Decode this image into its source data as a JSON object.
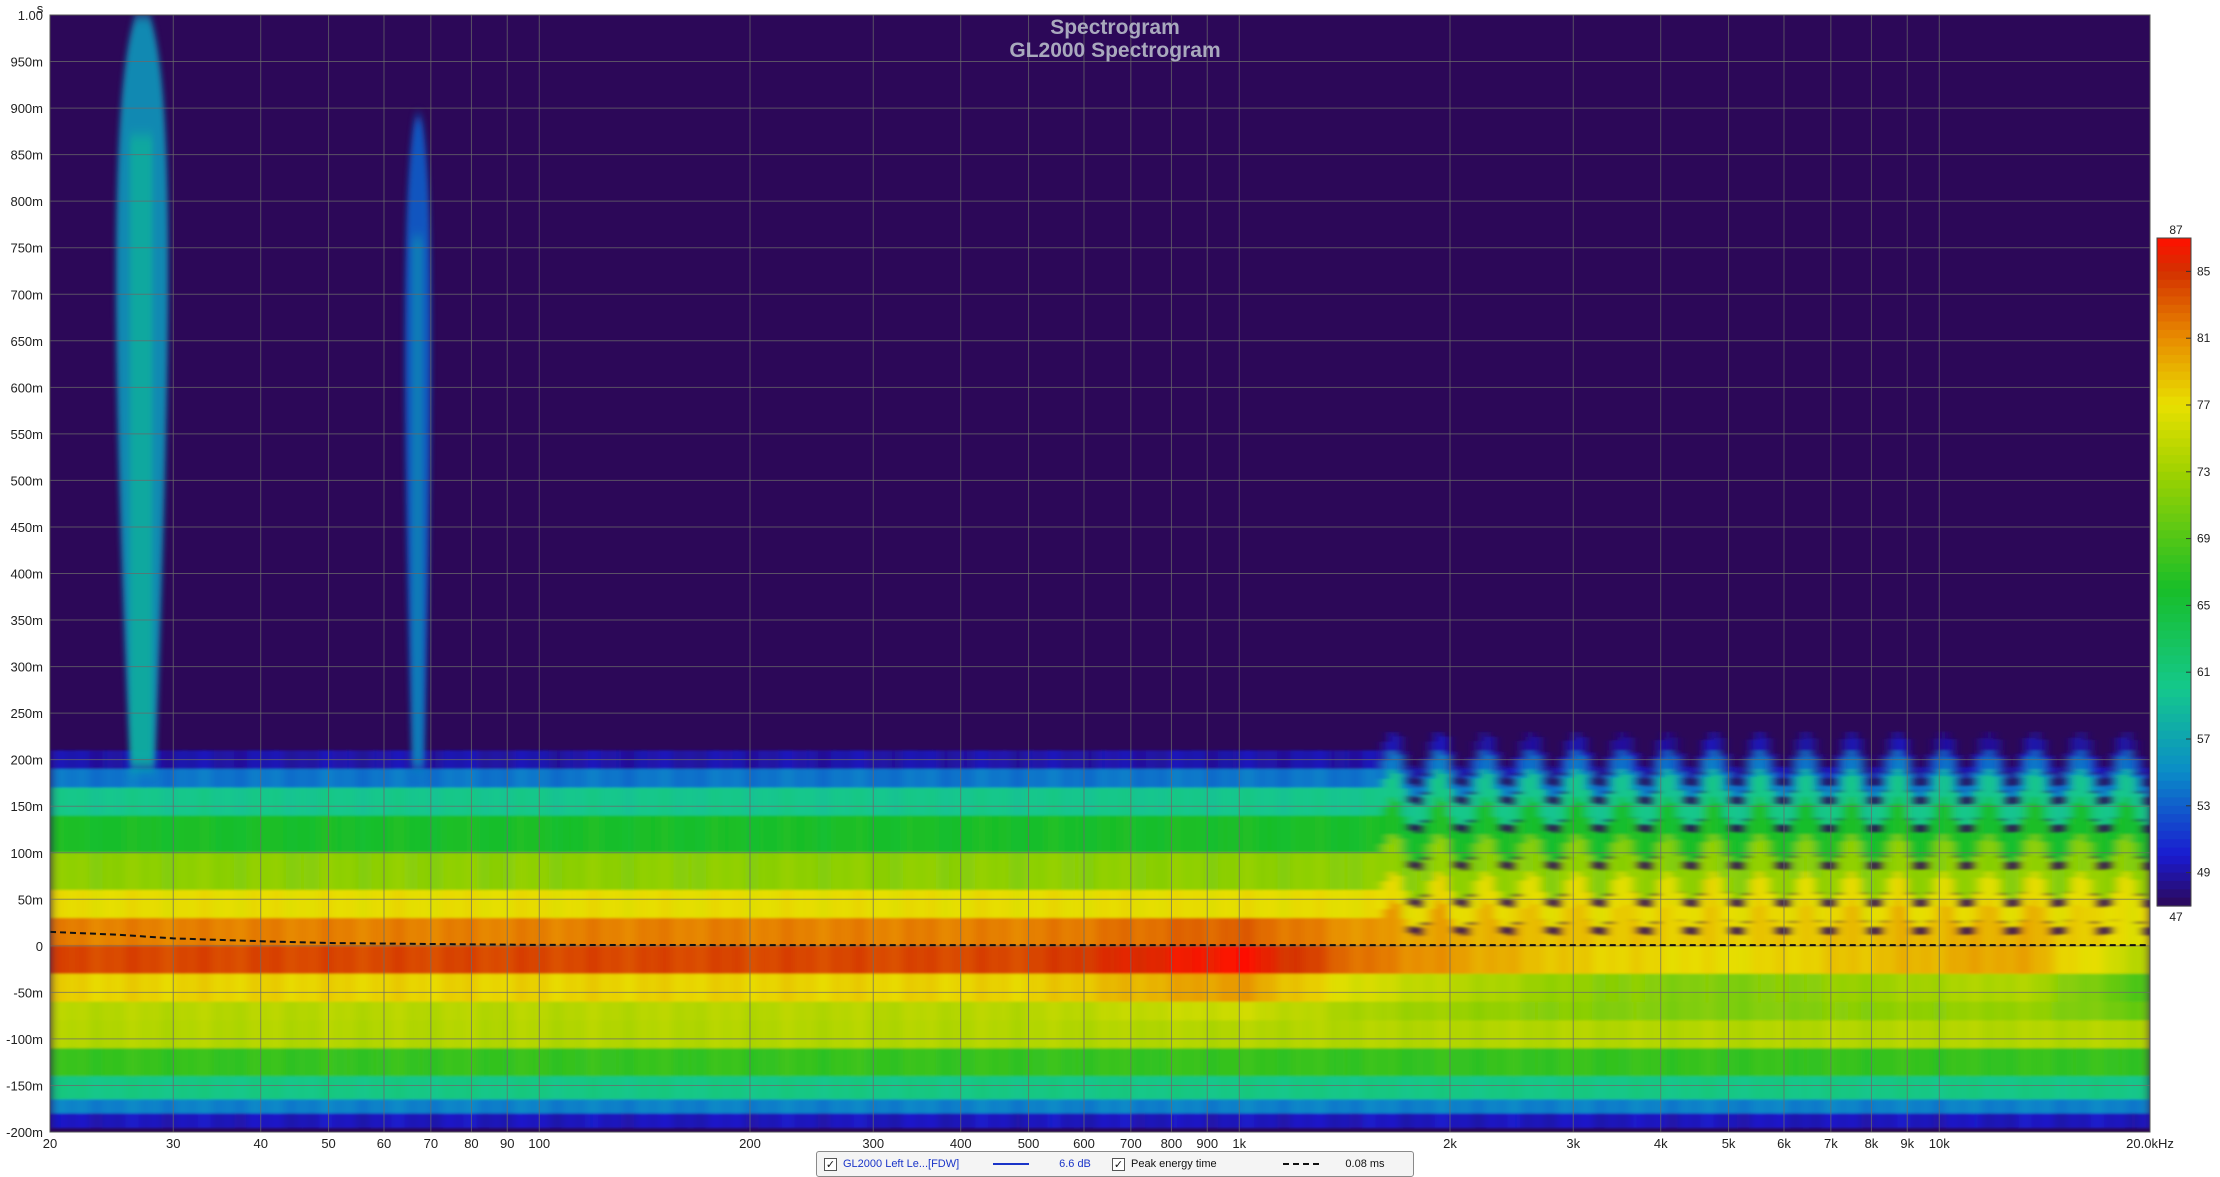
{
  "chart_data": {
    "type": "heatmap",
    "title": "Spectrogram",
    "subtitle": "GL2000 Spectrogram",
    "ylabel": "s",
    "xlabel": "",
    "x_scale": "log",
    "xlim": [
      20,
      20000
    ],
    "ylim": [
      -0.2,
      1.0
    ],
    "x_ticks": [
      {
        "v": 20,
        "label": "20"
      },
      {
        "v": 30,
        "label": "30"
      },
      {
        "v": 40,
        "label": "40"
      },
      {
        "v": 50,
        "label": "50"
      },
      {
        "v": 60,
        "label": "60"
      },
      {
        "v": 70,
        "label": "70"
      },
      {
        "v": 80,
        "label": "80"
      },
      {
        "v": 90,
        "label": "90"
      },
      {
        "v": 100,
        "label": "100"
      },
      {
        "v": 200,
        "label": "200"
      },
      {
        "v": 300,
        "label": "300"
      },
      {
        "v": 400,
        "label": "400"
      },
      {
        "v": 500,
        "label": "500"
      },
      {
        "v": 600,
        "label": "600"
      },
      {
        "v": 700,
        "label": "700"
      },
      {
        "v": 800,
        "label": "800"
      },
      {
        "v": 900,
        "label": "900"
      },
      {
        "v": 1000,
        "label": "1k"
      },
      {
        "v": 2000,
        "label": "2k"
      },
      {
        "v": 3000,
        "label": "3k"
      },
      {
        "v": 4000,
        "label": "4k"
      },
      {
        "v": 5000,
        "label": "5k"
      },
      {
        "v": 6000,
        "label": "6k"
      },
      {
        "v": 7000,
        "label": "7k"
      },
      {
        "v": 8000,
        "label": "8k"
      },
      {
        "v": 9000,
        "label": "9k"
      },
      {
        "v": 10000,
        "label": "10k"
      },
      {
        "v": 20000,
        "label": "20.0kHz"
      }
    ],
    "y_ticks": [
      {
        "v": 1.0,
        "label": "1.00"
      },
      {
        "v": 0.95,
        "label": "950m"
      },
      {
        "v": 0.9,
        "label": "900m"
      },
      {
        "v": 0.85,
        "label": "850m"
      },
      {
        "v": 0.8,
        "label": "800m"
      },
      {
        "v": 0.75,
        "label": "750m"
      },
      {
        "v": 0.7,
        "label": "700m"
      },
      {
        "v": 0.65,
        "label": "650m"
      },
      {
        "v": 0.6,
        "label": "600m"
      },
      {
        "v": 0.55,
        "label": "550m"
      },
      {
        "v": 0.5,
        "label": "500m"
      },
      {
        "v": 0.45,
        "label": "450m"
      },
      {
        "v": 0.4,
        "label": "400m"
      },
      {
        "v": 0.35,
        "label": "350m"
      },
      {
        "v": 0.3,
        "label": "300m"
      },
      {
        "v": 0.25,
        "label": "250m"
      },
      {
        "v": 0.2,
        "label": "200m"
      },
      {
        "v": 0.15,
        "label": "150m"
      },
      {
        "v": 0.1,
        "label": "100m"
      },
      {
        "v": 0.05,
        "label": "50m"
      },
      {
        "v": 0.0,
        "label": "0"
      },
      {
        "v": -0.05,
        "label": "-50m"
      },
      {
        "v": -0.1,
        "label": "-100m"
      },
      {
        "v": -0.15,
        "label": "-150m"
      },
      {
        "v": -0.2,
        "label": "-200m"
      }
    ],
    "colorbar": {
      "range": [
        47,
        87
      ],
      "ticks": [
        87,
        85,
        81,
        77,
        73,
        69,
        65,
        61,
        57,
        53,
        49,
        47
      ],
      "colors": [
        "#2b0a5c",
        "#1a1ad0",
        "#0aa0c8",
        "#18c870",
        "#1ec41e",
        "#e0e000",
        "#e88000",
        "#d02000",
        "#ff1000"
      ]
    },
    "background_color": "#2c0858",
    "grid": true,
    "series": [
      {
        "name": "GL2000 Left Le...[FDW]",
        "kind": "spectrogram",
        "freq": [
          20,
          30,
          60,
          100,
          200,
          500,
          800,
          1000,
          1500,
          3000,
          5000,
          9000,
          13000,
          20000
        ],
        "peak_level": [
          84,
          84,
          84,
          84,
          84,
          84,
          86,
          87,
          82,
          78,
          77,
          79,
          80,
          74
        ],
        "late_ridges": [
          {
            "freq": 27,
            "t_end": 1.0,
            "level": 56
          },
          {
            "freq": 67,
            "t_end": 0.89,
            "level": 53
          }
        ]
      },
      {
        "name": "Peak energy time",
        "kind": "line",
        "x": [
          20,
          25,
          30,
          40,
          50,
          70,
          100,
          200,
          1000,
          20000
        ],
        "y": [
          0.015,
          0.012,
          0.008,
          0.005,
          0.003,
          0.002,
          0.001,
          0.0008,
          0.0008,
          0.0008
        ]
      }
    ]
  },
  "legend": {
    "items": [
      {
        "name": "GL2000 Left Le...[FDW]",
        "value": "6.6 dB",
        "color": "#1a34c8",
        "checked": true
      },
      {
        "name": "Peak energy time",
        "value": "0.08 ms",
        "color": "#111111",
        "checked": true
      }
    ]
  }
}
